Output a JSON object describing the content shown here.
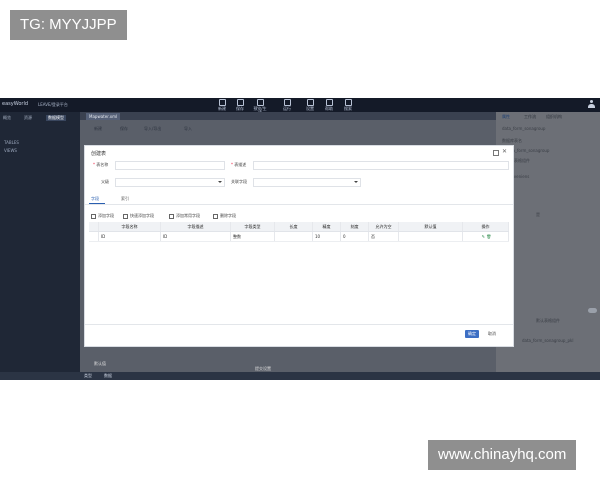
{
  "watermarks": {
    "top": "TG: MYYJJPP",
    "bottom": "www.chinayhq.com"
  },
  "app": {
    "logo": "easyWorld",
    "top_link": "LEAVE/登录平台",
    "toolbar": [
      {
        "label": "新建",
        "icon": "new-icon"
      },
      {
        "label": "保存",
        "icon": "save-icon"
      },
      {
        "label": "预览/生成",
        "icon": "preview-icon"
      },
      {
        "label": "运行",
        "icon": "run-icon"
      },
      {
        "label": "设置",
        "icon": "settings-icon"
      },
      {
        "label": "帮助",
        "icon": "help-icon"
      },
      {
        "label": "搜索",
        "icon": "search-icon"
      }
    ]
  },
  "sidebar": {
    "tabs": [
      "概览",
      "资源",
      "数据模型"
    ],
    "items": [
      "TABLES",
      "VIEWS"
    ]
  },
  "editor": {
    "file_tab": "Mapwater.xml",
    "toolbar": [
      "新建",
      "保存",
      "导入/导出",
      "导入"
    ]
  },
  "right_panel": {
    "tabs": [
      "属性",
      "工作流",
      "组织机构"
    ],
    "rows": [
      "data_form_sonagroup",
      "数据库表名",
      "data_form_sonagroup",
      "默认表格组件",
      "Conveniens",
      "是",
      "data_form_sonagroup_pkl",
      "默认表格组件"
    ]
  },
  "dialog": {
    "title": "创建表",
    "fields": {
      "table_name_label": "表名称",
      "table_desc_label": "表描述",
      "schema_label": "父级",
      "engine_label": "关联字段"
    },
    "tabs": [
      "字段",
      "索引"
    ],
    "actions": [
      "添加字段",
      "快速添加字段",
      "添加常用字段",
      "删除字段"
    ],
    "columns": [
      "",
      "字段名称",
      "字段描述",
      "字段类型",
      "长度",
      "精度",
      "刻度",
      "允许为空",
      "默认值",
      "操作"
    ],
    "rows": [
      [
        "",
        "ID",
        "ID",
        "整数",
        "",
        "10",
        "0",
        "否",
        "",
        "✎ 🗑"
      ]
    ],
    "ok_label": "确定",
    "cancel_label": "取消"
  },
  "underlay": {
    "left_label": "默认值",
    "right_label": "提交设置"
  },
  "status_bar": {
    "tabs": [
      "类型",
      "数据"
    ]
  }
}
